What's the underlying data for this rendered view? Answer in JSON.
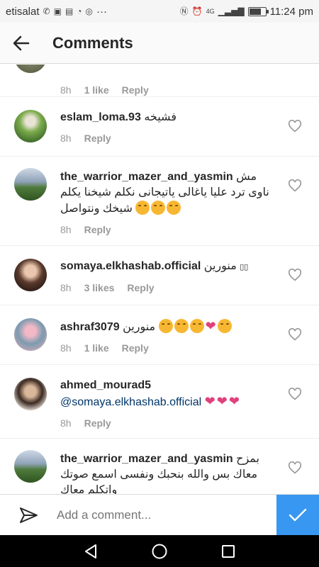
{
  "status_bar": {
    "carrier": "etisalat",
    "time": "11:24 pm",
    "overflow": "···",
    "network": "4G"
  },
  "header": {
    "title": "Comments",
    "back_icon": "arrow-left-icon"
  },
  "comments": [
    {
      "username": "",
      "text": "",
      "time": "8h",
      "likes": "1 like",
      "reply": "Reply"
    },
    {
      "username": "eslam_loma.93",
      "text": "فشيخه",
      "time": "8h",
      "likes": "",
      "reply": "Reply"
    },
    {
      "username": "the_warrior_mazer_and_yasmin",
      "text": "مش ناوى ترد عليا ياغالى ياتيجانى نكلم شيخنا يكلم شيخك ونتواصل",
      "time": "8h",
      "likes": "",
      "reply": "Reply"
    },
    {
      "username": "somaya.elkhashab.official",
      "text": "منورين",
      "time": "8h",
      "likes": "3 likes",
      "reply": "Reply"
    },
    {
      "username": "ashraf3079",
      "text": "منورين",
      "time": "8h",
      "likes": "1 like",
      "reply": "Reply"
    },
    {
      "username": "ahmed_mourad5",
      "mention": "@somaya.elkhashab.official",
      "time": "8h",
      "likes": "",
      "reply": "Reply"
    },
    {
      "username": "the_warrior_mazer_and_yasmin",
      "text": "بمزح معاك بس والله بنحبك ونفسى اسمع صوتك واتكلم معاك",
      "time": "",
      "likes": "",
      "reply": ""
    }
  ],
  "input": {
    "placeholder": "Add a comment..."
  },
  "colors": {
    "accent": "#3897f0",
    "heart_emoji": "#e0417b",
    "meta_text": "#999999"
  }
}
